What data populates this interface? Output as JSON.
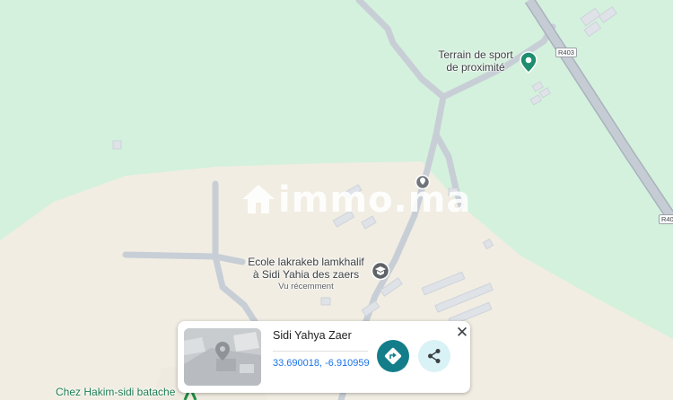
{
  "map": {
    "poi_sport": "Terrain de sport de proximité",
    "poi_sport_line1": "Terrain de sport",
    "poi_sport_line2": "de proximité",
    "poi_school_line1": "Ecole lakrakeb lamkhalif",
    "poi_school_line2": "à Sidi Yahia des zaers",
    "poi_school_sub": "Vu récemment",
    "poi_bottom": "Chez Hakim-sidi batache",
    "road_shield_1": "R403",
    "road_shield_2": "R40",
    "colors": {
      "green_area": "#d4f1dd",
      "sand_area": "#f1ede3",
      "road": "#c8ced6",
      "highway": "#b5bdc8",
      "accent": "#137e8a"
    },
    "icons": [
      "pin-teal-icon",
      "pin-gray-icon",
      "school-icon"
    ]
  },
  "watermark": {
    "text": "immo.ma"
  },
  "card": {
    "title": "Sidi Yahya Zaer",
    "coords": "33.690018, -6.910959",
    "close_label": "✕",
    "directions_icon": "directions-icon",
    "share_icon": "share-icon"
  }
}
